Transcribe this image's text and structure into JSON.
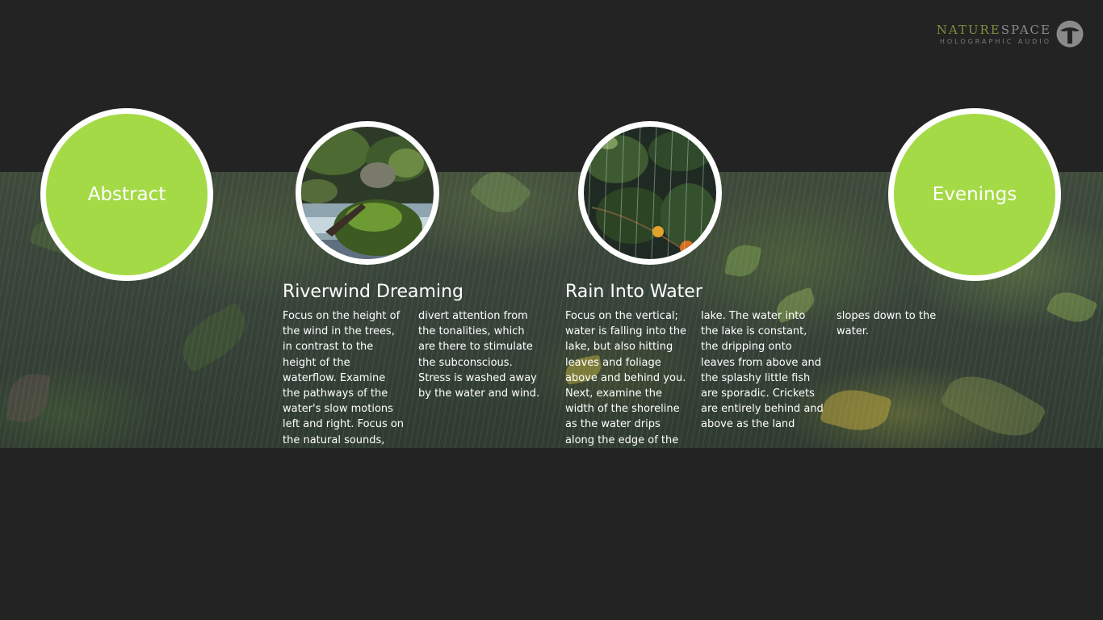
{
  "app": {
    "logo": {
      "word_a": "NATURE",
      "word_b": "SPACE",
      "tagline": "HOLOGRAPHIC AUDIO",
      "icon": "tree-icon"
    }
  },
  "categories": {
    "left": {
      "label": "Abstract"
    },
    "right": {
      "label": "Evenings"
    }
  },
  "tracks": [
    {
      "title": "Riverwind Dreaming",
      "thumbnail": "river-rocks-image",
      "description": "Focus on the height of the wind in the trees, in contrast to the height of the waterflow. Examine the pathways of the water's slow motions left and right. Focus on the natural sounds, divert attention from the tonalities, which are there to stimulate the subconscious. Stress is washed away by the water and wind."
    },
    {
      "title": "Rain Into Water",
      "thumbnail": "rain-foliage-image",
      "description": "Focus on the vertical; water is falling into the lake, but also hitting leaves and foliage above and behind you. Next, examine the width of the shoreline as the water drips along the edge of the lake. The water into the lake is constant, the dripping onto leaves from above and the splashy little fish are sporadic. Crickets are entirely behind and above as the land slopes down to the water."
    }
  ],
  "colors": {
    "background": "#232323",
    "accent_green": "#a4da46",
    "logo_olive": "#7b8f3c",
    "text": "#ffffff"
  }
}
